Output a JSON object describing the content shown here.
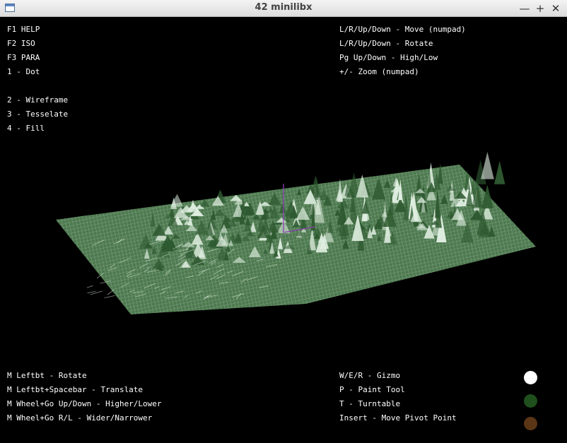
{
  "window": {
    "title": "42 minilibx",
    "minimize": "—",
    "maximize": "+",
    "close": "✕"
  },
  "help_left_top": [
    "F1 HELP",
    "F2 ISO",
    "F3 PARA",
    "1 - Dot",
    "2 - Wireframe",
    "3 - Tesselate",
    "4 - Fill"
  ],
  "help_right_top": [
    "L/R/Up/Down - Move (numpad)",
    "L/R/Up/Down - Rotate",
    "Pg Up/Down - High/Low",
    "+/- Zoom (numpad)"
  ],
  "help_left_bottom": [
    "M Leftbt - Rotate",
    "M Leftbt+Spacebar - Translate",
    "M Wheel+Go Up/Down - Higher/Lower",
    "M Wheel+Go R/L - Wider/Narrower"
  ],
  "help_right_bottom": [
    "W/E/R - Gizmo",
    "P - Paint Tool",
    "T - Turntable",
    "Insert - Move Pivot Point"
  ],
  "palette": {
    "swatch_1": "#ffffff",
    "swatch_2": "#1f4f1c",
    "swatch_3": "#5a3516"
  },
  "terrain": {
    "mesh_color": "#6fa072",
    "highlight_color": "#dfeee0",
    "gizmo_color": "#8a3fb4"
  }
}
